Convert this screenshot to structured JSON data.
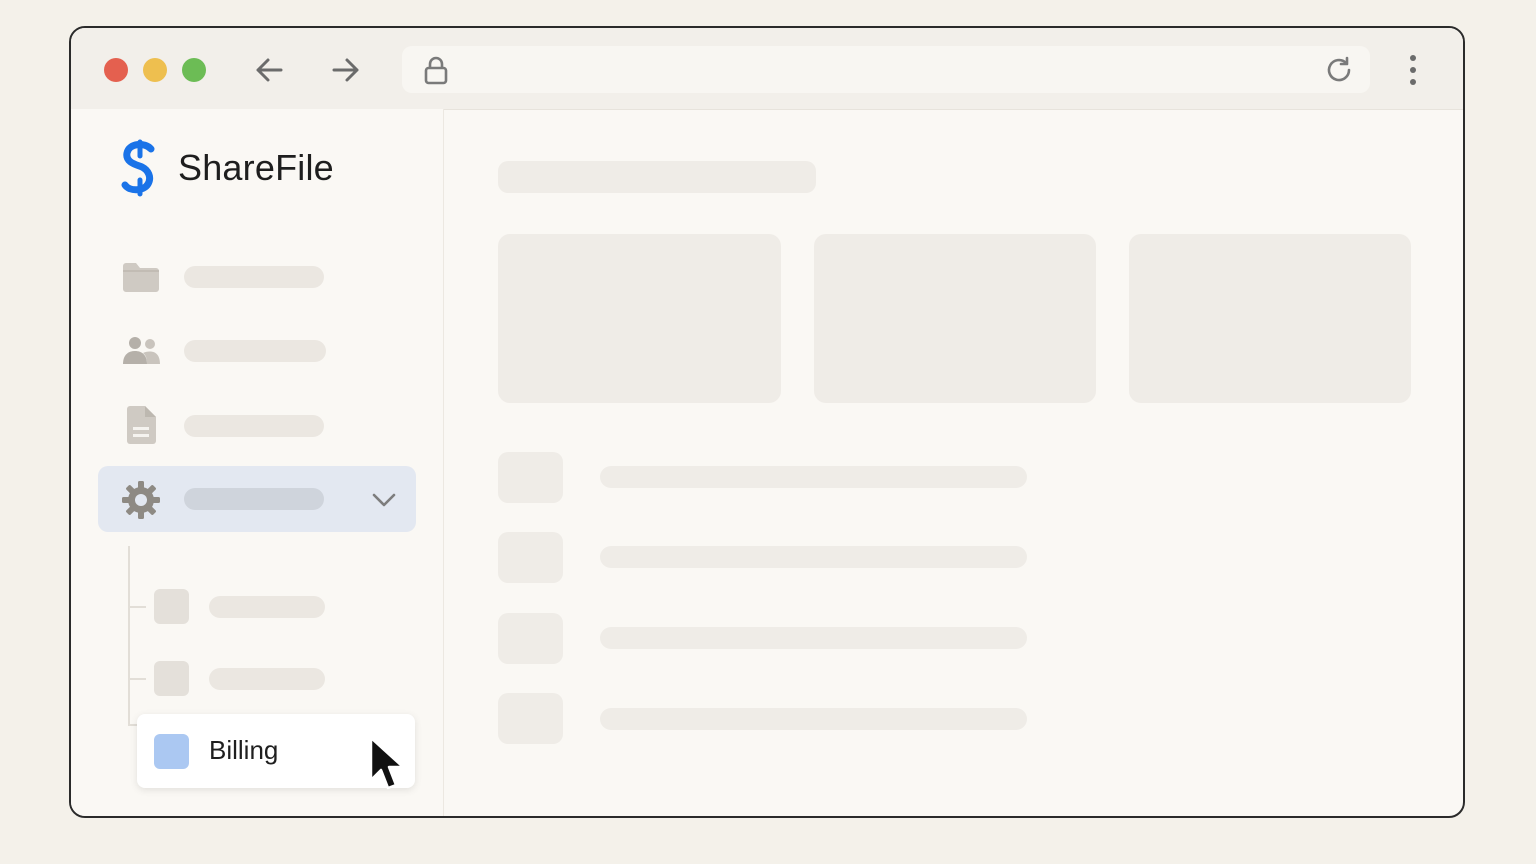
{
  "window": {
    "controls": {
      "close_color": "#e4604f",
      "minimize_color": "#eebf4f",
      "maximize_color": "#6cbc55"
    },
    "toolbar": {
      "back_icon": "arrow-left-icon",
      "forward_icon": "arrow-right-icon",
      "lock_icon": "lock-icon",
      "reload_icon": "reload-icon",
      "menu_icon": "kebab-menu-icon"
    }
  },
  "app": {
    "name": "ShareFile",
    "brand_color": "#1a73e8"
  },
  "sidebar": {
    "items": [
      {
        "icon": "folder-icon"
      },
      {
        "icon": "people-icon"
      },
      {
        "icon": "document-icon"
      },
      {
        "icon": "gear-icon",
        "active": true,
        "expanded": true
      }
    ],
    "subitems": [
      {
        "label": ""
      },
      {
        "label": ""
      },
      {
        "label": "Billing",
        "selected": true,
        "color": "#abc8f2"
      }
    ]
  }
}
